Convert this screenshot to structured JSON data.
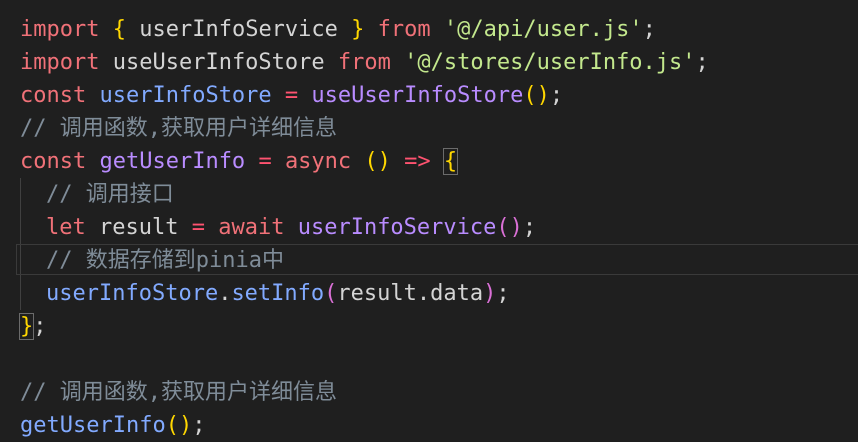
{
  "code": {
    "l1": {
      "kw": "import",
      "b1": "{",
      "id": "userInfoService",
      "b2": "}",
      "from": "from",
      "str": "'@/api/user.js'",
      "end": ";"
    },
    "l2": {
      "kw": "import",
      "id": "useUserInfoStore",
      "from": "from",
      "str": "'@/stores/userInfo.js'",
      "end": ";"
    },
    "l3": {
      "kw": "const",
      "id": "userInfoStore",
      "op": "=",
      "fn": "useUserInfoStore",
      "p": "()",
      "end": ";"
    },
    "l4": {
      "comment": "// 调用函数,获取用户详细信息"
    },
    "l5": {
      "kw": "const",
      "id": "getUserInfo",
      "op": "=",
      "async": "async",
      "p": "()",
      "arrow": "=>",
      "b": "{"
    },
    "l6": {
      "comment": "// 调用接口"
    },
    "l7": {
      "kw": "let",
      "id": "result",
      "op": "=",
      "await": "await",
      "fn": "userInfoService",
      "p": "()",
      "end": ";"
    },
    "l8": {
      "comment": "// 数据存储到pinia中"
    },
    "l9": {
      "obj": "userInfoStore",
      "dot": ".",
      "fn": "setInfo",
      "po": "(",
      "arg": "result",
      "dot2": ".",
      "prop": "data",
      "pc": ")",
      "end": ";"
    },
    "l10": {
      "b": "}",
      "end": ";"
    },
    "l12": {
      "comment": "// 调用函数,获取用户详细信息"
    },
    "l13": {
      "fn": "getUserInfo",
      "p": "()",
      "end": ";"
    }
  },
  "colors": {
    "background": "#1f1f1f",
    "keyword": "#f07178",
    "string": "#c3e88d",
    "function": "#82aaff",
    "comment": "#7f8c98",
    "bracket": "#ffd700"
  }
}
